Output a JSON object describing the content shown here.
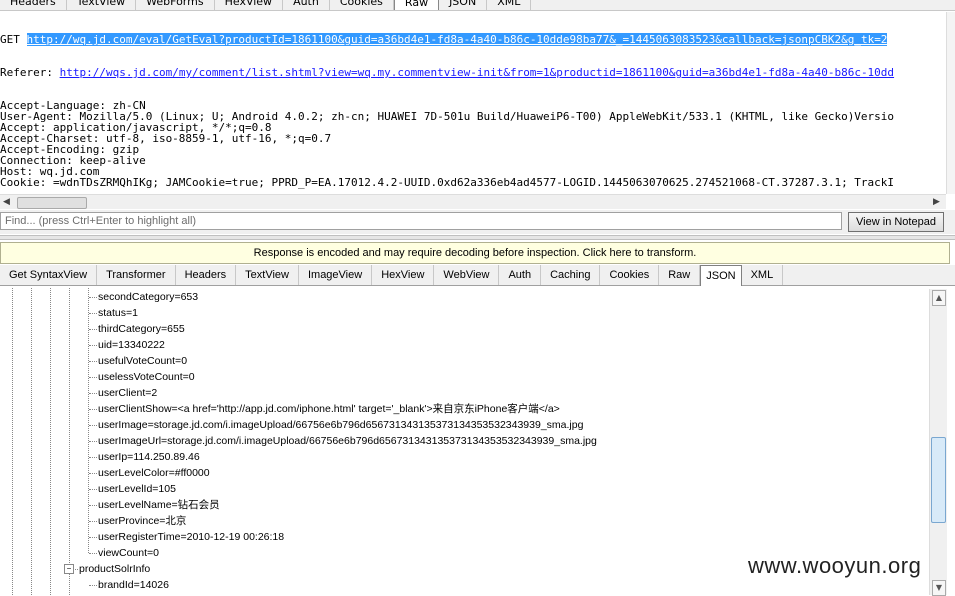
{
  "top_tabs": [
    "Headers",
    "TextView",
    "WebForms",
    "HexView",
    "Auth",
    "Cookies",
    "Raw",
    "JSON",
    "XML"
  ],
  "top_active_tab": "Raw",
  "request": {
    "get_prefix": "GET ",
    "get_url": "http://wq.jd.com/eval/GetEval?productId=1861100&guid=a36bd4e1-fd8a-4a40-b86c-10dde98ba77&_=1445063083523&callback=jsonpCBK2&g_tk=2",
    "referer_prefix": "Referer: ",
    "referer_url": "http://wqs.jd.com/my/comment/list.shtml?view=wq.my.commentview-init&from=1&productid=1861100&guid=a36bd4e1-fd8a-4a40-b86c-10dd",
    "lines": [
      "Accept-Language: zh-CN",
      "User-Agent: Mozilla/5.0 (Linux; U; Android 4.0.2; zh-cn; HUAWEI 7D-501u Build/HuaweiP6-T00) AppleWebKit/533.1 (KHTML, like Gecko)Versio",
      "Accept: application/javascript, */*;q=0.8",
      "Accept-Charset: utf-8, iso-8859-1, utf-16, *;q=0.7",
      "Accept-Encoding: gzip",
      "Connection: keep-alive",
      "Host: wq.jd.com",
      "Cookie: =wdnTDsZRMQhIKg; JAMCookie=true; PPRD_P=EA.17012.4.2-UUID.0xd62a336eb4ad4577-LOGID.1445063070625.274521068-CT.37287.3.1; TrackI"
    ]
  },
  "find": {
    "placeholder": "Find... (press Ctrl+Enter to highlight all)",
    "notepad_button": "View in Notepad"
  },
  "banner": "Response is encoded and may require decoding before inspection. Click here to transform.",
  "bottom_tabs": [
    "Get SyntaxView",
    "Transformer",
    "Headers",
    "TextView",
    "ImageView",
    "HexView",
    "WebView",
    "Auth",
    "Caching",
    "Cookies",
    "Raw",
    "JSON",
    "XML"
  ],
  "bottom_active_tab": "JSON",
  "tree_nodes": [
    {
      "text": "secondCategory=653",
      "level": 2
    },
    {
      "text": "status=1",
      "level": 2
    },
    {
      "text": "thirdCategory=655",
      "level": 2
    },
    {
      "text": "uid=13340222",
      "level": 2
    },
    {
      "text": "usefulVoteCount=0",
      "level": 2
    },
    {
      "text": "uselessVoteCount=0",
      "level": 2
    },
    {
      "text": "userClient=2",
      "level": 2
    },
    {
      "text": "userClientShow=<a href='http://app.jd.com/iphone.html' target='_blank'>来自京东iPhone客户端</a>",
      "level": 2
    },
    {
      "text": "userImage=storage.jd.com/i.imageUpload/66756e6b796d656731343135373134353532343939_sma.jpg",
      "level": 2
    },
    {
      "text": "userImageUrl=storage.jd.com/i.imageUpload/66756e6b796d656731343135373134353532343939_sma.jpg",
      "level": 2
    },
    {
      "text": "userIp=114.250.89.46",
      "level": 2
    },
    {
      "text": "userLevelColor=#ff0000",
      "level": 2
    },
    {
      "text": "userLevelId=105",
      "level": 2
    },
    {
      "text": "userLevelName=钻石会员",
      "level": 2
    },
    {
      "text": "userProvince=北京",
      "level": 2
    },
    {
      "text": "userRegisterTime=2010-12-19 00:26:18",
      "level": 2
    },
    {
      "text": "viewCount=0",
      "level": 2
    },
    {
      "text": "productSolrInfo",
      "level": 1,
      "expander": "−"
    },
    {
      "text": "brandId=14026",
      "level": 2
    }
  ],
  "watermark": "www.wooyun.org"
}
